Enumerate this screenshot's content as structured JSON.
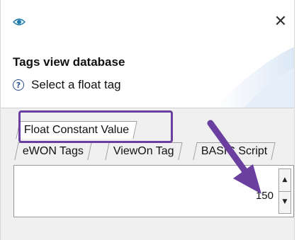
{
  "window": {
    "icon": "eye-icon",
    "close_glyph": "✕"
  },
  "header": {
    "title": "Tags view database",
    "help_icon": "question-icon",
    "help_glyph": "?",
    "subtitle": "Select a float tag"
  },
  "tabs": {
    "row1": [
      {
        "label": "Float Constant Value",
        "active": true
      }
    ],
    "row2": [
      {
        "label": "eWON Tags"
      },
      {
        "label": "ViewOn Tag"
      },
      {
        "label": "BASIC Script"
      }
    ]
  },
  "field": {
    "value": "150",
    "spin_up_glyph": "▲",
    "spin_down_glyph": "▼"
  },
  "colors": {
    "annotation": "#6b3fa0",
    "dialog_background": "#f0f0f0"
  }
}
